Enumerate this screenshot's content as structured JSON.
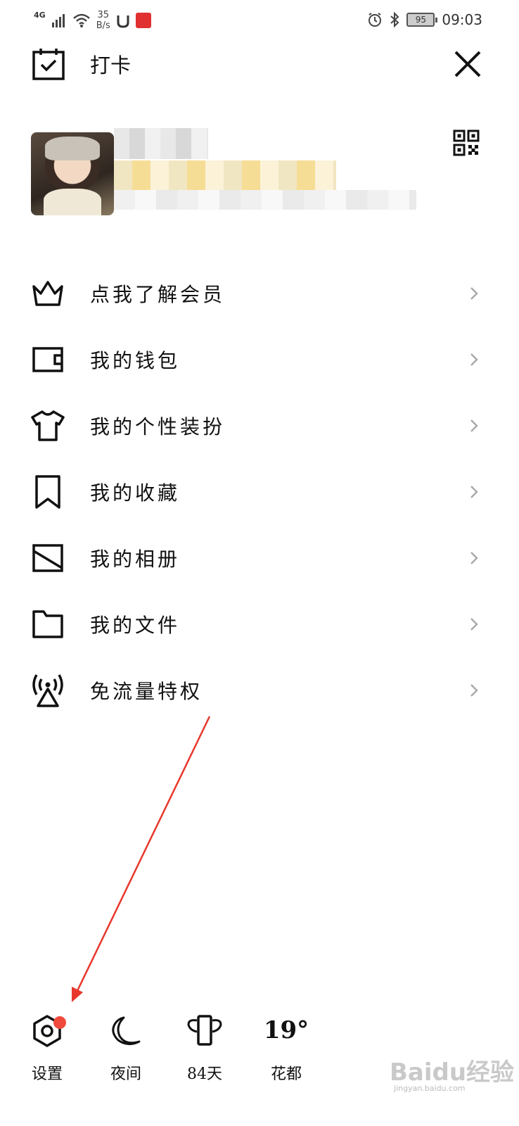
{
  "status_bar": {
    "network": "4G",
    "speed_value": "35",
    "speed_unit": "B/s",
    "battery": "95",
    "time": "09:03"
  },
  "header": {
    "checkin_label": "打卡"
  },
  "menu": {
    "items": [
      {
        "label": "点我了解会员",
        "icon": "crown-icon"
      },
      {
        "label": "我的钱包",
        "icon": "wallet-icon"
      },
      {
        "label": "我的个性装扮",
        "icon": "tshirt-icon"
      },
      {
        "label": "我的收藏",
        "icon": "bookmark-icon"
      },
      {
        "label": "我的相册",
        "icon": "image-icon"
      },
      {
        "label": "我的文件",
        "icon": "folder-icon"
      },
      {
        "label": "免流量特权",
        "icon": "signal-tower-icon"
      }
    ]
  },
  "bottom_bar": {
    "settings_label": "设置",
    "night_label": "夜间",
    "days_label": "84天",
    "weather_temp": "19°",
    "weather_city": "花都"
  },
  "watermark": {
    "text": "Baidu经验",
    "sub": "jingyan.baidu.com"
  },
  "colors": {
    "accent_red": "#f04a3c",
    "annotation_red": "#e8372c"
  }
}
